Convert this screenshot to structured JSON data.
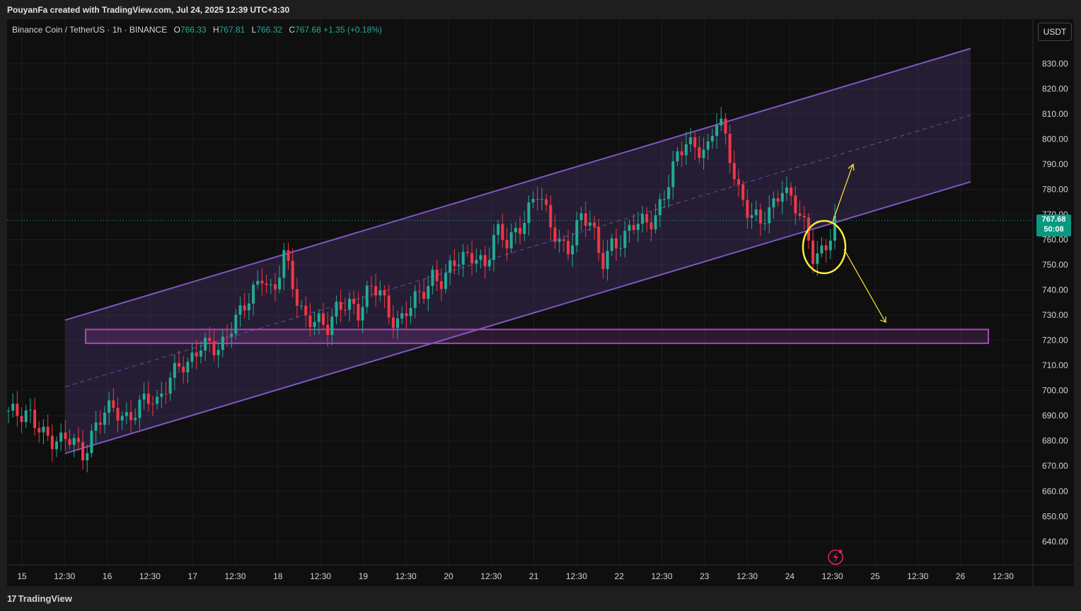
{
  "header": {
    "credit": "PouyanFa created with TradingView.com, Jul 24, 2025 12:39 UTC+3:30"
  },
  "legend": {
    "symbol": "Binance Coin / TetherUS · 1h · BINANCE",
    "open_label": "O",
    "open": "766.33",
    "high_label": "H",
    "high": "767.81",
    "low_label": "L",
    "low": "766.32",
    "close_label": "C",
    "close": "767.68",
    "change": "+1.35 (+0.18%)"
  },
  "currency_button": "USDT",
  "price_tag": {
    "price": "767.68",
    "countdown": "50:08"
  },
  "footer": {
    "brand": "TradingView",
    "logo_icon": "tradingview-logo-icon"
  },
  "colors": {
    "up": "#22ab94",
    "down": "#f23645",
    "channel": "#7e57c2",
    "zone": "#ab47bc",
    "annotation": "#ffeb3b",
    "background": "#0f0f0f"
  },
  "chart_data": {
    "type": "candlestick",
    "symbol": "BNBUSDT",
    "interval": "1h",
    "exchange": "BINANCE",
    "yaxis": {
      "ticks": [
        640,
        650,
        660,
        670,
        680,
        690,
        700,
        710,
        720,
        730,
        740,
        750,
        760,
        770,
        780,
        790,
        800,
        810,
        820,
        830
      ],
      "ylim": [
        633,
        848
      ]
    },
    "xaxis": {
      "ticks": [
        "15",
        "12:30",
        "16",
        "12:30",
        "17",
        "12:30",
        "18",
        "12:30",
        "19",
        "12:30",
        "20",
        "12:30",
        "21",
        "12:30",
        "22",
        "12:30",
        "23",
        "12:30",
        "24",
        "12:30",
        "25",
        "12:30",
        "26",
        "12:30"
      ]
    },
    "last_price": 767.68,
    "price_path": [
      [
        0,
        692
      ],
      [
        1,
        688
      ],
      [
        2,
        690
      ],
      [
        3,
        687
      ],
      [
        4,
        680
      ],
      [
        5,
        678
      ],
      [
        6,
        681
      ],
      [
        7,
        676
      ],
      [
        8,
        684
      ],
      [
        9,
        690
      ],
      [
        10,
        692
      ],
      [
        11,
        690
      ],
      [
        12,
        693
      ],
      [
        13,
        696
      ],
      [
        14,
        693
      ],
      [
        15,
        705
      ],
      [
        16,
        712
      ],
      [
        17,
        708
      ],
      [
        18,
        716
      ],
      [
        19,
        720
      ],
      [
        20,
        718
      ],
      [
        21,
        724
      ],
      [
        22,
        730
      ],
      [
        23,
        740
      ],
      [
        24,
        748
      ],
      [
        25,
        736
      ],
      [
        26,
        753
      ],
      [
        27,
        740
      ],
      [
        28,
        730
      ],
      [
        29,
        728
      ],
      [
        30,
        722
      ],
      [
        31,
        733
      ],
      [
        32,
        738
      ],
      [
        33,
        730
      ],
      [
        34,
        738
      ],
      [
        35,
        741
      ],
      [
        36,
        731
      ],
      [
        37,
        727
      ],
      [
        38,
        733
      ],
      [
        39,
        738
      ],
      [
        40,
        747
      ],
      [
        41,
        744
      ],
      [
        42,
        749
      ],
      [
        43,
        752
      ],
      [
        44,
        756
      ],
      [
        45,
        750
      ],
      [
        46,
        762
      ],
      [
        47,
        758
      ],
      [
        48,
        765
      ],
      [
        49,
        772
      ],
      [
        50,
        778
      ],
      [
        51,
        766
      ],
      [
        52,
        760
      ],
      [
        53,
        758
      ],
      [
        54,
        768
      ],
      [
        55,
        765
      ],
      [
        56,
        752
      ],
      [
        57,
        760
      ],
      [
        58,
        758
      ],
      [
        59,
        765
      ],
      [
        60,
        768
      ],
      [
        61,
        770
      ],
      [
        62,
        778
      ],
      [
        63,
        790
      ],
      [
        64,
        800
      ],
      [
        65,
        798
      ],
      [
        66,
        795
      ],
      [
        67,
        808
      ],
      [
        68,
        795
      ],
      [
        69,
        780
      ],
      [
        70,
        770
      ],
      [
        71,
        765
      ],
      [
        72,
        772
      ],
      [
        73,
        783
      ],
      [
        74,
        776
      ],
      [
        75,
        765
      ],
      [
        76,
        752
      ],
      [
        77,
        758
      ],
      [
        78,
        767.68
      ]
    ],
    "channel": {
      "upper": [
        [
          92,
          728
        ],
        [
          1372,
          836
        ]
      ],
      "lower": [
        [
          92,
          675
        ],
        [
          1372,
          783
        ]
      ],
      "mid": [
        [
          92,
          701.5
        ],
        [
          1372,
          809.5
        ]
      ]
    },
    "support_zone": {
      "top": 724.3,
      "bottom": 718.8
    },
    "annotations": [
      "circle around breakdown",
      "arrow up toward 790",
      "arrow down toward 728"
    ]
  }
}
